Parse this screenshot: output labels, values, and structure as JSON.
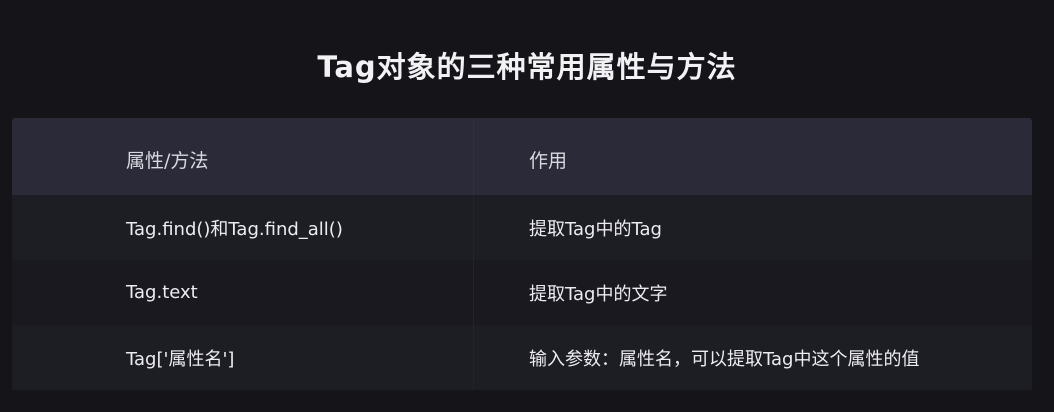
{
  "title": "Tag对象的三种常用属性与方法",
  "table": {
    "headers": [
      "属性/方法",
      "作用"
    ],
    "rows": [
      [
        "Tag.find()和Tag.find_all()",
        "提取Tag中的Tag"
      ],
      [
        "Tag.text",
        "提取Tag中的文字"
      ],
      [
        "Tag['属性名']",
        "输入参数：属性名，可以提取Tag中这个属性的值"
      ]
    ]
  },
  "colors": {
    "background": "#141419",
    "header_row": "#2a2a39",
    "row_odd": "#1d1d24",
    "row_even": "#19191f",
    "text": "#ececf0"
  }
}
